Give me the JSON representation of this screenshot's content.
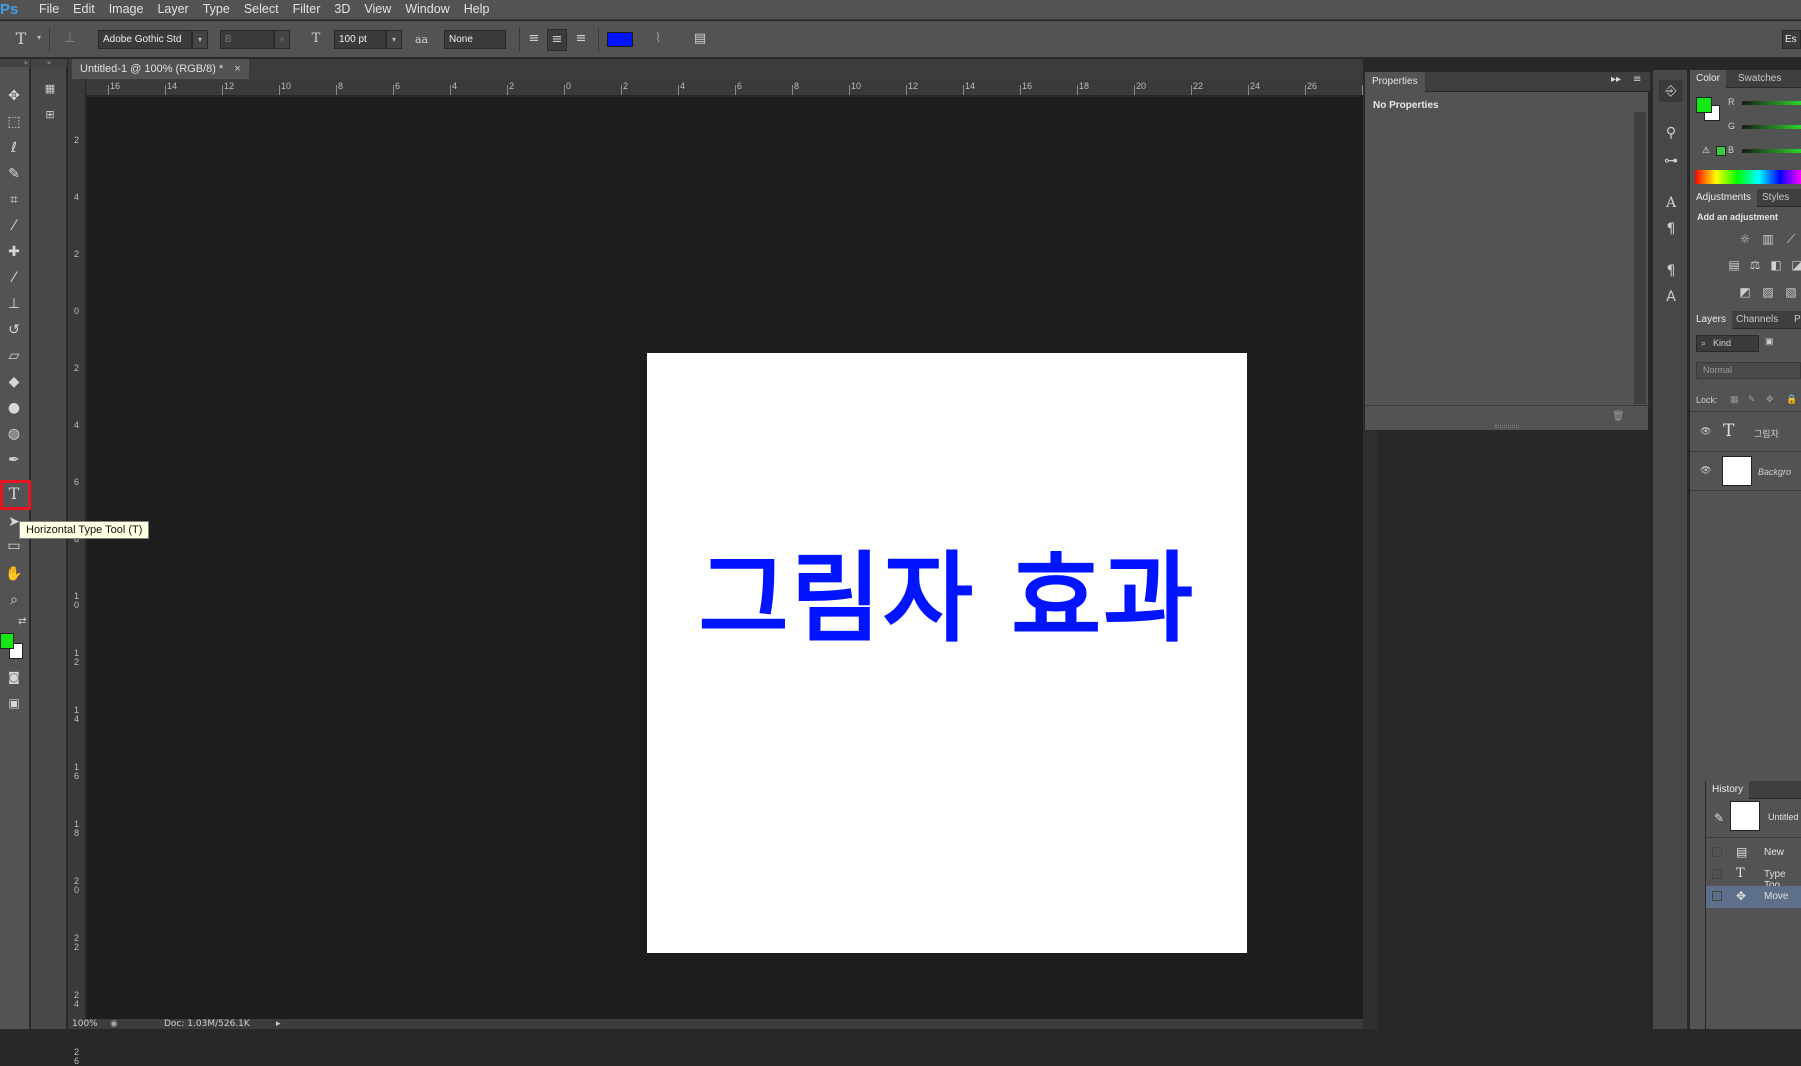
{
  "app": {
    "logo": "Ps"
  },
  "menu": [
    "File",
    "Edit",
    "Image",
    "Layer",
    "Type",
    "Select",
    "Filter",
    "3D",
    "View",
    "Window",
    "Help"
  ],
  "options": {
    "tool_icon": "T",
    "font_family": "Adobe Gothic Std",
    "font_style": "B",
    "font_size": "100 pt",
    "aa_icon": "aa",
    "anti_alias": "None",
    "text_color": "#0014ff",
    "workspace": "Es"
  },
  "document": {
    "tab_title": "Untitled-1 @ 100% (RGB/8) *",
    "tab_close": "×",
    "canvas_text": "그림자 효과",
    "text_color": "#0014ff",
    "hruler_labels": [
      "16",
      "14",
      "12",
      "10",
      "8",
      "6",
      "4",
      "2",
      "0",
      "2",
      "4",
      "6",
      "8",
      "10",
      "12",
      "14",
      "16",
      "18",
      "20",
      "22",
      "24",
      "26",
      "2"
    ],
    "vruler_labels": [
      "2",
      "4",
      "2",
      "0",
      "2",
      "4",
      "6",
      "8",
      "1\n0",
      "1\n2",
      "1\n4",
      "1\n6",
      "1\n8",
      "2\n0",
      "2\n2",
      "2\n4",
      "2\n6"
    ],
    "zoom": "100%",
    "doc_info": "Doc: 1.03M/526.1K"
  },
  "tooltip": "Horizontal Type Tool (T)",
  "colors": {
    "foreground": "#14e814",
    "background": "#ffffff",
    "highlight": "#e8141e"
  },
  "properties": {
    "tab": "Properties",
    "content": "No Properties"
  },
  "color_panel": {
    "tabs": [
      "Color",
      "Swatches"
    ],
    "channels": [
      "R",
      "G",
      "B"
    ]
  },
  "adjustments": {
    "tabs": [
      "Adjustments",
      "Styles"
    ],
    "title": "Add an adjustment"
  },
  "layers": {
    "tabs": [
      "Layers",
      "Channels",
      "P"
    ],
    "filter_kind": "Kind",
    "blend_mode": "Normal",
    "lock_label": "Lock:",
    "items": [
      {
        "name": "그림자",
        "type": "text"
      },
      {
        "name": "Backgro",
        "type": "background"
      }
    ]
  },
  "history": {
    "tab": "History",
    "snapshot": "Untitled",
    "items": [
      "New",
      "Type Too",
      "Move"
    ]
  }
}
